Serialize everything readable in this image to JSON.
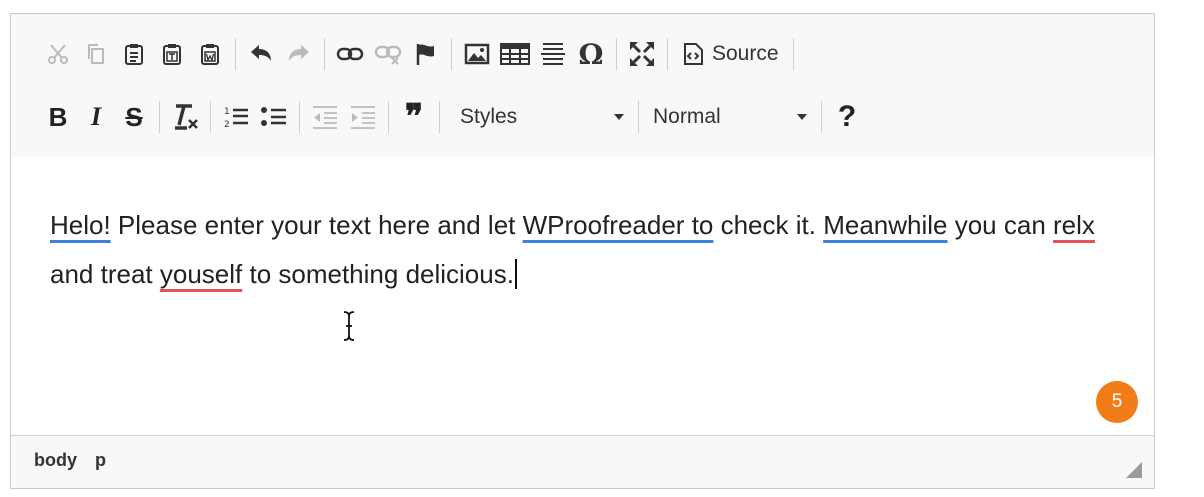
{
  "toolbar": {
    "row1": [
      {
        "name": "cut-button",
        "icon": "scissors-icon",
        "enabled": false
      },
      {
        "name": "copy-button",
        "icon": "copy-icon",
        "enabled": false
      },
      {
        "name": "paste-button",
        "icon": "clipboard-icon",
        "enabled": true
      },
      {
        "name": "paste-text-button",
        "icon": "clipboard-text-icon",
        "enabled": true
      },
      {
        "name": "paste-word-button",
        "icon": "clipboard-word-icon",
        "enabled": true
      },
      {
        "name": "undo-button",
        "icon": "undo-icon",
        "enabled": true
      },
      {
        "name": "redo-button",
        "icon": "redo-icon",
        "enabled": false
      },
      {
        "name": "link-button",
        "icon": "link-icon",
        "enabled": true
      },
      {
        "name": "unlink-button",
        "icon": "unlink-icon",
        "enabled": false
      },
      {
        "name": "anchor-button",
        "icon": "flag-icon",
        "enabled": true
      },
      {
        "name": "image-button",
        "icon": "image-icon",
        "enabled": true
      },
      {
        "name": "table-button",
        "icon": "table-icon",
        "enabled": true
      },
      {
        "name": "horizontal-line-button",
        "icon": "horizontal-line-icon",
        "enabled": true
      },
      {
        "name": "special-char-button",
        "icon": "omega-icon",
        "enabled": true
      },
      {
        "name": "maximize-button",
        "icon": "maximize-icon",
        "enabled": true
      }
    ],
    "source_label": "Source",
    "styles_label": "Styles",
    "format_label": "Normal",
    "bold_label": "B",
    "italic_label": "I",
    "strike_label": "S",
    "quote_label": "❞",
    "help_label": "?"
  },
  "content": {
    "segments": [
      {
        "text": "Helo!",
        "mark": "blue"
      },
      {
        "text": " Please enter your text here and let ",
        "mark": ""
      },
      {
        "text": "WProofreader to",
        "mark": "blue"
      },
      {
        "text": " check it. ",
        "mark": ""
      },
      {
        "text": "Meanwhile",
        "mark": "blue"
      },
      {
        "text": " you can ",
        "mark": ""
      },
      {
        "text": "relx",
        "mark": "red"
      },
      {
        "text": " and treat ",
        "mark": ""
      },
      {
        "text": "youself",
        "mark": "red"
      },
      {
        "text": " to something delicious.",
        "mark": ""
      }
    ],
    "badge_count": "5",
    "badge_color": "#f07d18"
  },
  "statusbar": {
    "path": [
      "body",
      "p"
    ]
  }
}
